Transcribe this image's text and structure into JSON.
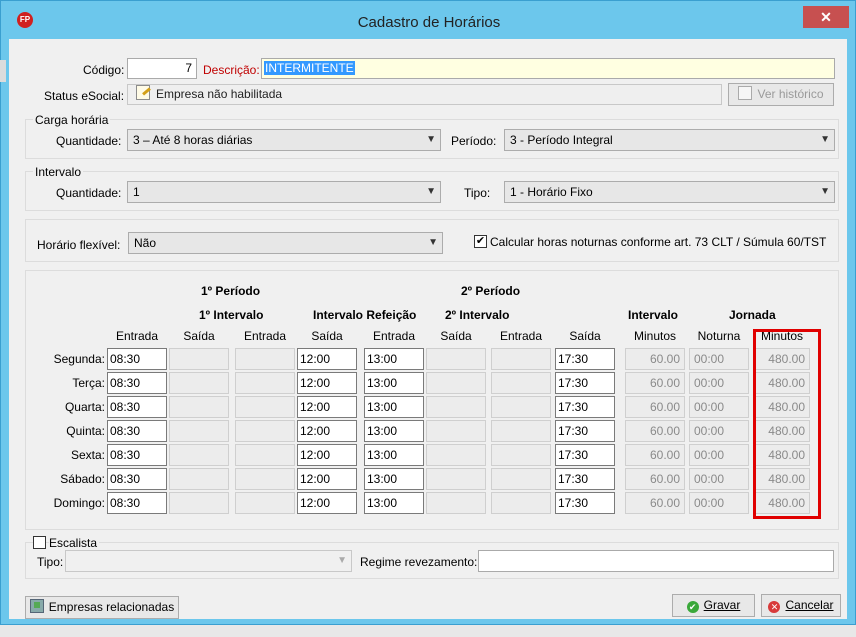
{
  "window": {
    "title": "Cadastro de Horários",
    "app_icon": "FP",
    "close_label": "✕"
  },
  "top": {
    "codigo_label": "Código:",
    "codigo_value": "7",
    "descricao_label": "Descrição:",
    "descricao_value": "INTERMITENTE",
    "status_label": "Status eSocial:",
    "status_value": "Empresa não habilitada",
    "ver_historico": "Ver histórico"
  },
  "carga": {
    "title": "Carga horária",
    "quantidade_label": "Quantidade:",
    "quantidade_value": "3 – Até 8 horas diárias",
    "periodo_label": "Período:",
    "periodo_value": "3 - Período Integral"
  },
  "intervalo": {
    "title": "Intervalo",
    "quantidade_label": "Quantidade:",
    "quantidade_value": "1",
    "tipo_label": "Tipo:",
    "tipo_value": "1 - Horário Fixo"
  },
  "flex": {
    "label": "Horário flexível:",
    "value": "Não",
    "noturno_checked": true,
    "noturno_label": "Calcular horas noturnas conforme art. 73 CLT / Súmula 60/TST"
  },
  "schedule": {
    "h_primeiro_periodo": "1º Período",
    "h_primeiro_intervalo": "1º Intervalo",
    "h_intervalo_refeicao": "Intervalo Refeição",
    "h_segundo_periodo": "2º Período",
    "h_segundo_intervalo": "2º Intervalo",
    "h_intervalo": "Intervalo",
    "h_jornada": "Jornada",
    "col_headers": [
      "Entrada",
      "Saída",
      "Entrada",
      "Saída",
      "Entrada",
      "Saída",
      "Entrada",
      "Saída",
      "Minutos",
      "Noturna",
      "Minutos"
    ],
    "rows": [
      {
        "day": "Segunda:",
        "cells": [
          "08:30",
          "",
          "",
          "12:00",
          "13:00",
          "",
          "",
          "17:30",
          "60.00",
          "00:00",
          "480.00"
        ]
      },
      {
        "day": "Terça:",
        "cells": [
          "08:30",
          "",
          "",
          "12:00",
          "13:00",
          "",
          "",
          "17:30",
          "60.00",
          "00:00",
          "480.00"
        ]
      },
      {
        "day": "Quarta:",
        "cells": [
          "08:30",
          "",
          "",
          "12:00",
          "13:00",
          "",
          "",
          "17:30",
          "60.00",
          "00:00",
          "480.00"
        ]
      },
      {
        "day": "Quinta:",
        "cells": [
          "08:30",
          "",
          "",
          "12:00",
          "13:00",
          "",
          "",
          "17:30",
          "60.00",
          "00:00",
          "480.00"
        ]
      },
      {
        "day": "Sexta:",
        "cells": [
          "08:30",
          "",
          "",
          "12:00",
          "13:00",
          "",
          "",
          "17:30",
          "60.00",
          "00:00",
          "480.00"
        ]
      },
      {
        "day": "Sábado:",
        "cells": [
          "08:30",
          "",
          "",
          "12:00",
          "13:00",
          "",
          "",
          "17:30",
          "60.00",
          "00:00",
          "480.00"
        ]
      },
      {
        "day": "Domingo:",
        "cells": [
          "08:30",
          "",
          "",
          "12:00",
          "13:00",
          "",
          "",
          "17:30",
          "60.00",
          "00:00",
          "480.00"
        ]
      }
    ]
  },
  "escala": {
    "escalista_label": "Escalista",
    "escalista_checked": false,
    "tipo_label": "Tipo:",
    "tipo_value": "",
    "regime_label": "Regime revezamento:",
    "regime_value": ""
  },
  "buttons": {
    "empresas": "Empresas relacionadas",
    "gravar": "Gravar",
    "cancelar": "Cancelar"
  },
  "colors": {
    "titlebar": "#6cc7ec",
    "close": "#c75050",
    "highlight_box": "#e00000",
    "descricao_label": "#c00000",
    "descricao_bg": "#ffffe1",
    "selection": "#3399ff"
  }
}
